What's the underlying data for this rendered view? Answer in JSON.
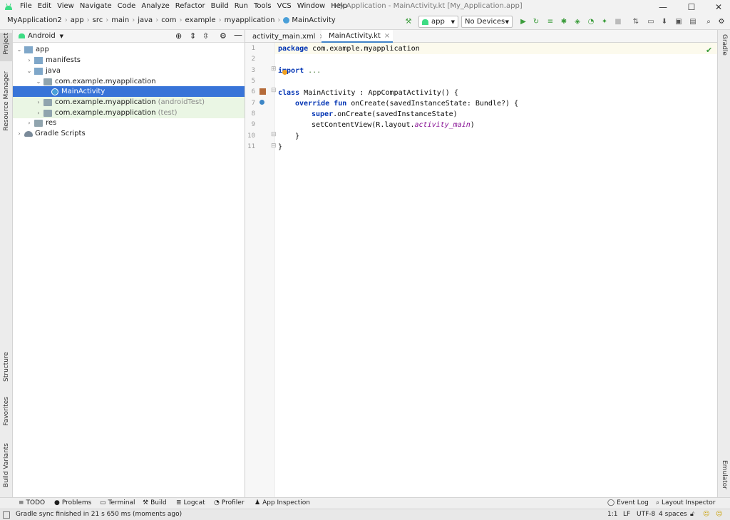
{
  "menu": [
    "File",
    "Edit",
    "View",
    "Navigate",
    "Code",
    "Analyze",
    "Refactor",
    "Build",
    "Run",
    "Tools",
    "VCS",
    "Window",
    "Help"
  ],
  "window_title": "My Application - MainActivity.kt [My_Application.app]",
  "window_controls": {
    "minimize": "—",
    "maximize": "☐",
    "close": "✕"
  },
  "breadcrumbs": [
    "MyApplication2",
    "app",
    "src",
    "main",
    "java",
    "com",
    "example",
    "myapplication",
    "MainActivity"
  ],
  "run_config": "app",
  "device": "No Devices",
  "project_panel": {
    "view": "Android",
    "tree": [
      {
        "label": "app",
        "hint": ""
      },
      {
        "label": "manifests",
        "hint": ""
      },
      {
        "label": "java",
        "hint": ""
      },
      {
        "label": "com.example.myapplication",
        "hint": ""
      },
      {
        "label": "MainActivity",
        "hint": ""
      },
      {
        "label": "com.example.myapplication",
        "hint": "(androidTest)"
      },
      {
        "label": "com.example.myapplication",
        "hint": "(test)"
      },
      {
        "label": "res",
        "hint": ""
      },
      {
        "label": "Gradle Scripts",
        "hint": ""
      }
    ]
  },
  "left_tabs": [
    "Project",
    "Resource Manager",
    "Structure",
    "Favorites",
    "Build Variants"
  ],
  "right_tabs": [
    "Gradle",
    "Emulator"
  ],
  "editor": {
    "tabs": [
      "activity_main.xml",
      "MainActivity.kt"
    ],
    "line_numbers": [
      "1",
      "2",
      "3",
      "5",
      "6",
      "7",
      "8",
      "9",
      "10",
      "11"
    ],
    "code": {
      "l1_kw": "package",
      "l1_rest": " com.example.myapplication",
      "l3_kw": "import",
      "l3_rest": " ...",
      "l6_kw": "class",
      "l6_rest": " MainActivity : AppCompatActivity() {",
      "l7_kw": "override fun",
      "l7_rest": " onCreate(savedInstanceState: Bundle?) {",
      "l8_kw": "super",
      "l8_rest": ".onCreate(savedInstanceState)",
      "l9_a": "setContentView(R.layout.",
      "l9_it": "activity_main",
      "l9_b": ")",
      "l10": "}",
      "l11": "}"
    }
  },
  "bottom_tools": [
    "TODO",
    "Problems",
    "Terminal",
    "Build",
    "Logcat",
    "Profiler",
    "App Inspection"
  ],
  "bottom_right_tools": [
    "Event Log",
    "Layout Inspector"
  ],
  "status": {
    "message": "Gradle sync finished in 21 s 650 ms (moments ago)",
    "position": "1:1",
    "line_sep": "LF",
    "encoding": "UTF-8",
    "indent": "4 spaces"
  },
  "colors": {
    "accent": "#3874d8",
    "keyword": "#0033b3",
    "android_green": "#3ddc84"
  }
}
